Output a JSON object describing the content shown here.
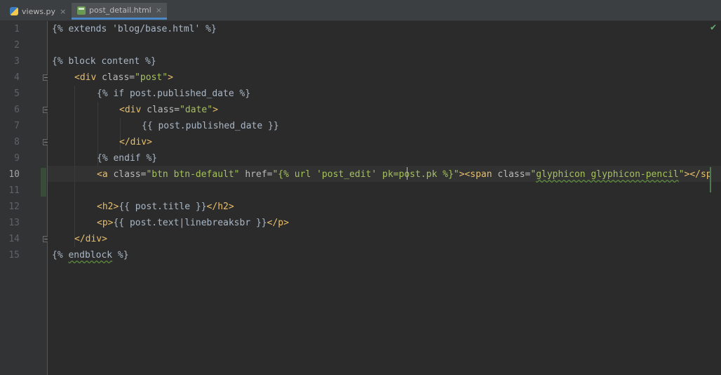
{
  "tabs": [
    {
      "label": "views.py",
      "icon": "python-file-icon",
      "close": "×",
      "active": false
    },
    {
      "label": "post_detail.html",
      "icon": "html-file-icon",
      "close": "×",
      "active": true
    }
  ],
  "line_numbers": [
    "1",
    "2",
    "3",
    "4",
    "5",
    "6",
    "7",
    "8",
    "9",
    "10",
    "11",
    "12",
    "13",
    "14",
    "15"
  ],
  "current_line": "10",
  "code": {
    "l1": "{% extends 'blog/base.html' %}",
    "l3": "{% block content %}",
    "l4_open": "<div ",
    "l4_attr": "class=",
    "l4_val": "\"post\"",
    "l4_close": ">",
    "l5": "{% if post.published_date %}",
    "l6_open": "<div ",
    "l6_attr": "class=",
    "l6_val": "\"date\"",
    "l6_close": ">",
    "l7": "{{ post.published_date }}",
    "l8": "</div>",
    "l9": "{% endif %}",
    "l10_a": "<a ",
    "l10_attr1": "class=",
    "l10_val1": "\"btn btn-default\"",
    "l10_attr2": " href=",
    "l10_val2": "\"{% url 'post_edit' pk=post.pk %}\"",
    "l10_span": "><span ",
    "l10_attr3": "class=",
    "l10_val3a": "\"",
    "l10_val3b": "glyphicon glyphicon-pencil",
    "l10_val3c": "\"",
    "l10_rest": "></sp",
    "l12_open": "<h2>",
    "l12_mid": "{{ post.title }}",
    "l12_close": "</h2>",
    "l13_open": "<p>",
    "l13_mid": "{{ post.text|linebreaksbr }}",
    "l13_close": "</p>",
    "l14": "</div>",
    "l15_a": "{% ",
    "l15_b": "endblock",
    "l15_c": " %}"
  },
  "colors": {
    "background": "#2b2b2b",
    "tag": "#e8bf6a",
    "string": "#a5c25c",
    "text": "#a9b7c6",
    "accent": "#4a88c7"
  },
  "status": {
    "inspection_icon": "check-icon",
    "inspection_symbol": "✔"
  }
}
